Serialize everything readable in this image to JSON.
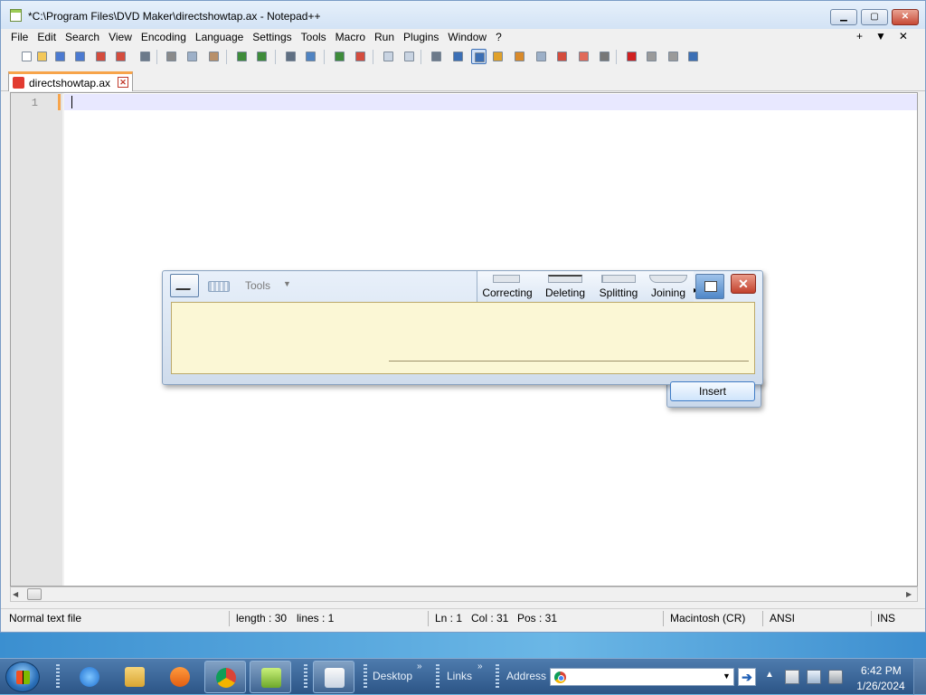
{
  "window": {
    "title": "*C:\\Program Files\\DVD Maker\\directshowtap.ax - Notepad++",
    "min_label": "▁",
    "max_label": "▢",
    "close_label": "✕"
  },
  "menu": {
    "items": [
      "File",
      "Edit",
      "Search",
      "View",
      "Encoding",
      "Language",
      "Settings",
      "Tools",
      "Macro",
      "Run",
      "Plugins",
      "Window",
      "?"
    ],
    "right": [
      "+",
      "▼",
      "✕"
    ]
  },
  "toolbar": {
    "icons": [
      "new-file-icon",
      "open-file-icon",
      "save-icon",
      "save-all-icon",
      "close-icon",
      "close-all-icon",
      "print-icon",
      "cut-icon",
      "copy-icon",
      "paste-icon",
      "undo-icon",
      "redo-icon",
      "find-icon",
      "replace-icon",
      "zoom-in-icon",
      "zoom-out-icon",
      "sync-vertical-icon",
      "sync-horizontal-icon",
      "word-wrap-icon",
      "show-all-chars-icon",
      "indent-guide-icon",
      "user-language-icon",
      "doc-map-icon",
      "function-list-icon",
      "folder-as-workspace-icon",
      "monitoring-icon",
      "record-macro-icon",
      "stop-macro-icon",
      "play-macro-icon",
      "run-macro-multiple-icon",
      "save-macro-icon"
    ]
  },
  "tab": {
    "label": "directshowtap.ax",
    "close_label": "✕"
  },
  "editor": {
    "line_number": "1",
    "line_text": ""
  },
  "status": {
    "file_type": "Normal text file",
    "length": "length : 30",
    "lines": "lines : 1",
    "ln": "Ln : 1",
    "col": "Col : 31",
    "pos": "Pos : 31",
    "eol": "Macintosh (CR)",
    "encoding": "ANSI",
    "mode": "INS"
  },
  "input_panel": {
    "tools_label": "Tools",
    "tools_arrow": "▼",
    "gestures": [
      "Correcting",
      "Deleting",
      "Splitting",
      "Joining"
    ],
    "more_arrow": "▸",
    "close_label": "✕",
    "insert_label": "Insert"
  },
  "taskbar": {
    "desktop_label": "Desktop",
    "links_label": "Links",
    "address_label": "Address",
    "address_value": "",
    "chevron": "»",
    "go_label": "➔",
    "tray_arrow": "▲",
    "clock_time": "6:42 PM",
    "clock_date": "1/26/2024",
    "colors": {
      "strip": "#4a9ad6",
      "taskbar": "#3a679b"
    }
  }
}
